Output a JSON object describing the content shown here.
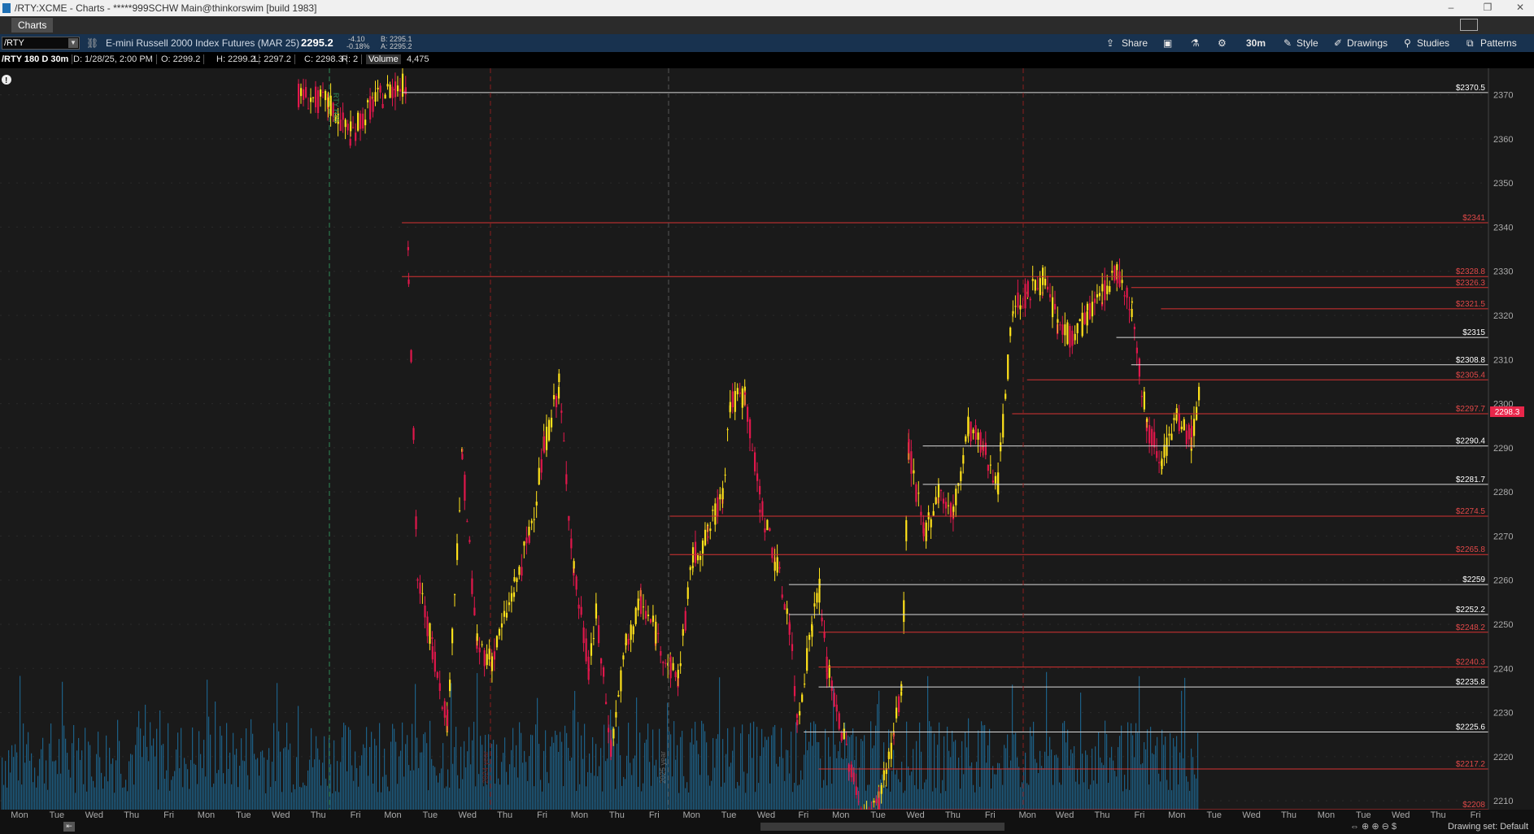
{
  "window": {
    "title": "/RTY:XCME - Charts - *****999SCHW Main@thinkorswim [build 1983]",
    "controls": [
      "–",
      "❐",
      "✕"
    ]
  },
  "tabs": [
    {
      "label": "Charts"
    }
  ],
  "toolbar": {
    "symbol": "/RTY",
    "description": "E-mini Russell 2000 Index Futures (MAR 25)",
    "last": "2295.2",
    "net_change": "-4.10",
    "pct_change": "-0.18%",
    "bid": "B: 2295.1",
    "ask": "A: 2295.2",
    "share_label": "Share",
    "timeframe": "30m",
    "style_label": "Style",
    "drawings_label": "Drawings",
    "studies_label": "Studies",
    "patterns_label": "Patterns"
  },
  "infobar": {
    "header": "/RTY 180 D 30m",
    "date": "D: 1/28/25, 2:00 PM",
    "open": "O: 2299.2",
    "high": "H: 2299.2",
    "low": "L: 2297.2",
    "close": "C: 2298.3",
    "range": "R: 2",
    "volume_label": "Volume",
    "volume_value": "4,475"
  },
  "chart_data": {
    "type": "candlestick",
    "symbol": "/RTY",
    "ylim": [
      2208,
      2376
    ],
    "y_ticks": [
      2370,
      2360,
      2350,
      2340,
      2330,
      2320,
      2310,
      2300,
      2290,
      2280,
      2270,
      2260,
      2250,
      2240,
      2230,
      2220,
      2210
    ],
    "current_price": "2298.3",
    "price_levels": [
      {
        "label": "$2370.5",
        "value": 2370.5,
        "color": "white",
        "from": 0.27
      },
      {
        "label": "$2341",
        "value": 2341,
        "color": "red",
        "from": 0.27
      },
      {
        "label": "$2328.8",
        "value": 2328.8,
        "color": "red",
        "from": 0.27
      },
      {
        "label": "$2326.3",
        "value": 2326.3,
        "color": "red",
        "from": 0.76
      },
      {
        "label": "$2321.5",
        "value": 2321.5,
        "color": "red",
        "from": 0.78
      },
      {
        "label": "$2315",
        "value": 2315,
        "color": "white",
        "from": 0.75
      },
      {
        "label": "$2308.8",
        "value": 2308.8,
        "color": "white",
        "from": 0.76
      },
      {
        "label": "$2305.4",
        "value": 2305.4,
        "color": "red",
        "from": 0.69
      },
      {
        "label": "$2297.7",
        "value": 2297.7,
        "color": "red",
        "from": 0.68
      },
      {
        "label": "$2290.4",
        "value": 2290.4,
        "color": "white",
        "from": 0.62
      },
      {
        "label": "$2281.7",
        "value": 2281.7,
        "color": "white",
        "from": 0.62
      },
      {
        "label": "$2274.5",
        "value": 2274.5,
        "color": "red",
        "from": 0.45
      },
      {
        "label": "$2265.8",
        "value": 2265.8,
        "color": "red",
        "from": 0.45
      },
      {
        "label": "$2259",
        "value": 2259,
        "color": "white",
        "from": 0.53
      },
      {
        "label": "$2252.2",
        "value": 2252.2,
        "color": "white",
        "from": 0.53
      },
      {
        "label": "$2248.2",
        "value": 2248.2,
        "color": "red",
        "from": 0.55
      },
      {
        "label": "$2240.3",
        "value": 2240.3,
        "color": "red",
        "from": 0.55
      },
      {
        "label": "$2235.8",
        "value": 2235.8,
        "color": "white",
        "from": 0.55
      },
      {
        "label": "$2225.6",
        "value": 2225.6,
        "color": "white",
        "from": 0.54
      },
      {
        "label": "$2217.2",
        "value": 2217.2,
        "color": "red",
        "from": 0.55
      },
      {
        "label": "$2208",
        "value": 2208,
        "color": "red",
        "from": 0.55
      }
    ],
    "x_ticks": [
      "Mon",
      "Tue",
      "Wed",
      "Thu",
      "Fri",
      "Mon",
      "Tue",
      "Wed",
      "Thu",
      "Fri",
      "Mon",
      "Tue",
      "Wed",
      "Thu",
      "Fri",
      "Mon",
      "Thu",
      "Fri",
      "Mon",
      "Tue",
      "Wed",
      "Fri",
      "Mon",
      "Tue",
      "Wed",
      "Thu",
      "Fri",
      "Mon",
      "Wed",
      "Thu",
      "Fri",
      "Mon",
      "Tue",
      "Wed",
      "Thu",
      "Mon",
      "Tue",
      "Wed",
      "Thu",
      "Fri"
    ],
    "price_path": [
      [
        0.2,
        2370
      ],
      [
        0.22,
        2368
      ],
      [
        0.235,
        2361
      ],
      [
        0.25,
        2368
      ],
      [
        0.265,
        2372
      ],
      [
        0.272,
        2372
      ],
      [
        0.274,
        2330
      ],
      [
        0.28,
        2260
      ],
      [
        0.29,
        2245
      ],
      [
        0.3,
        2228
      ],
      [
        0.31,
        2288
      ],
      [
        0.32,
        2245
      ],
      [
        0.33,
        2242
      ],
      [
        0.345,
        2258
      ],
      [
        0.355,
        2270
      ],
      [
        0.365,
        2290
      ],
      [
        0.375,
        2304
      ],
      [
        0.385,
        2262
      ],
      [
        0.395,
        2240
      ],
      [
        0.4,
        2252
      ],
      [
        0.41,
        2222
      ],
      [
        0.42,
        2245
      ],
      [
        0.43,
        2255
      ],
      [
        0.44,
        2248
      ],
      [
        0.45,
        2240
      ],
      [
        0.455,
        2238
      ],
      [
        0.465,
        2265
      ],
      [
        0.475,
        2270
      ],
      [
        0.485,
        2280
      ],
      [
        0.49,
        2300
      ],
      [
        0.5,
        2302
      ],
      [
        0.51,
        2278
      ],
      [
        0.52,
        2265
      ],
      [
        0.53,
        2250
      ],
      [
        0.535,
        2228
      ],
      [
        0.545,
        2250
      ],
      [
        0.55,
        2258
      ],
      [
        0.555,
        2240
      ],
      [
        0.58,
        2205
      ],
      [
        0.59,
        2210
      ],
      [
        0.6,
        2225
      ],
      [
        0.605,
        2235
      ],
      [
        0.61,
        2290
      ],
      [
        0.62,
        2270
      ],
      [
        0.63,
        2280
      ],
      [
        0.64,
        2275
      ],
      [
        0.65,
        2295
      ],
      [
        0.66,
        2290
      ],
      [
        0.67,
        2282
      ],
      [
        0.68,
        2322
      ],
      [
        0.69,
        2325
      ],
      [
        0.7,
        2328
      ],
      [
        0.71,
        2318
      ],
      [
        0.72,
        2315
      ],
      [
        0.73,
        2320
      ],
      [
        0.74,
        2325
      ],
      [
        0.75,
        2330
      ],
      [
        0.76,
        2322
      ],
      [
        0.77,
        2295
      ],
      [
        0.78,
        2288
      ],
      [
        0.79,
        2296
      ],
      [
        0.8,
        2292
      ],
      [
        0.805,
        2302
      ]
    ],
    "volume_range": [
      0,
      160
    ]
  },
  "chart_labels": {
    "rotated_markers": [
      "RTY H25",
      "2025 year",
      "2024 year"
    ],
    "alert_icon": "!"
  },
  "statusbar": {
    "drawing_set": "Drawing set: Default"
  }
}
